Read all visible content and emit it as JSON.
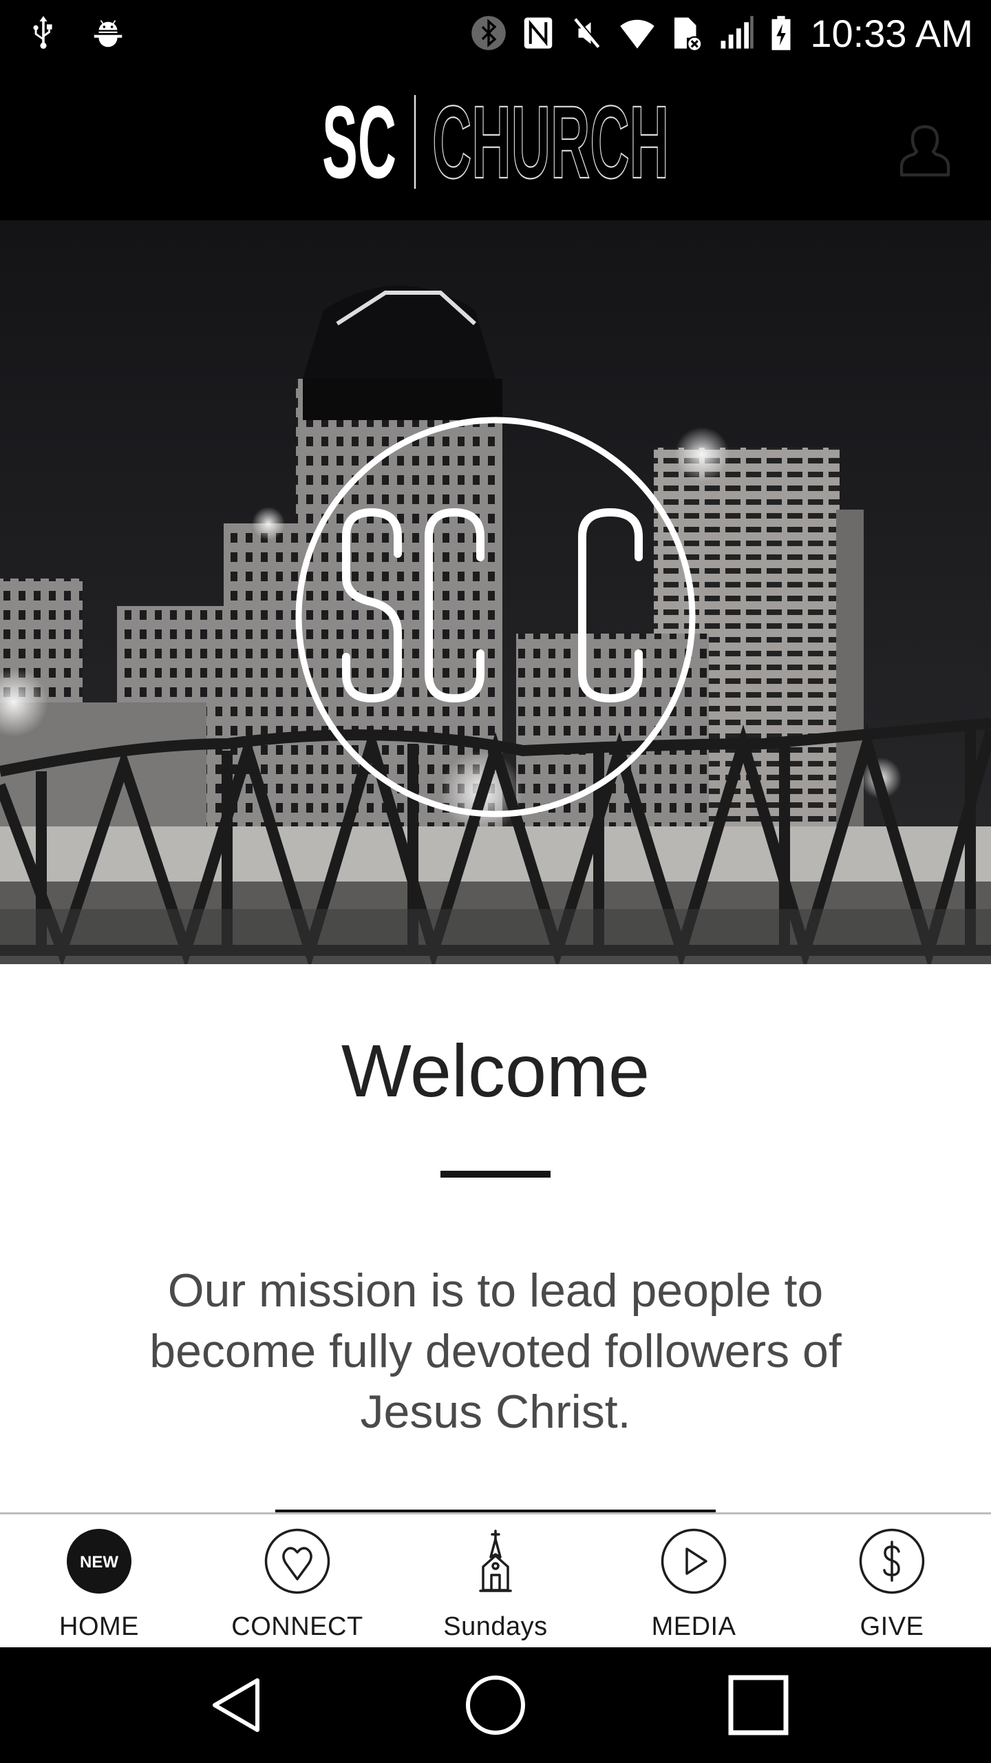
{
  "status_bar": {
    "time": "10:33 AM",
    "left_icons": [
      "usb-icon",
      "android-debug-icon"
    ],
    "right_icons": [
      "bluetooth-icon",
      "nfc-icon",
      "mute-icon",
      "wifi-icon",
      "no-sim-icon",
      "signal-icon",
      "battery-charging-icon"
    ]
  },
  "header": {
    "logo_bold": "SC",
    "logo_outline": "CHURCH",
    "profile_icon": "user-profile-icon"
  },
  "hero": {
    "logo_text": "SCC",
    "image_description": "black-and-white city skyline at night with truss bridge"
  },
  "content": {
    "title": "Welcome",
    "mission": "Our mission is to lead people to become fully devoted followers of Jesus Christ."
  },
  "bottom_nav": {
    "items": [
      {
        "label": "HOME",
        "icon": "new-badge-icon",
        "badge": "NEW",
        "active": true
      },
      {
        "label": "CONNECT",
        "icon": "heart-icon",
        "active": false
      },
      {
        "label": "Sundays",
        "icon": "church-icon",
        "active": false
      },
      {
        "label": "MEDIA",
        "icon": "play-icon",
        "active": false
      },
      {
        "label": "GIVE",
        "icon": "dollar-icon",
        "active": false
      }
    ]
  },
  "system_nav": {
    "buttons": [
      "back",
      "home",
      "recents"
    ]
  },
  "colors": {
    "header_bg": "#000000",
    "text_dark": "#222222",
    "mission_text": "#4a4a4a",
    "nav_border": "#bdbdbd"
  }
}
